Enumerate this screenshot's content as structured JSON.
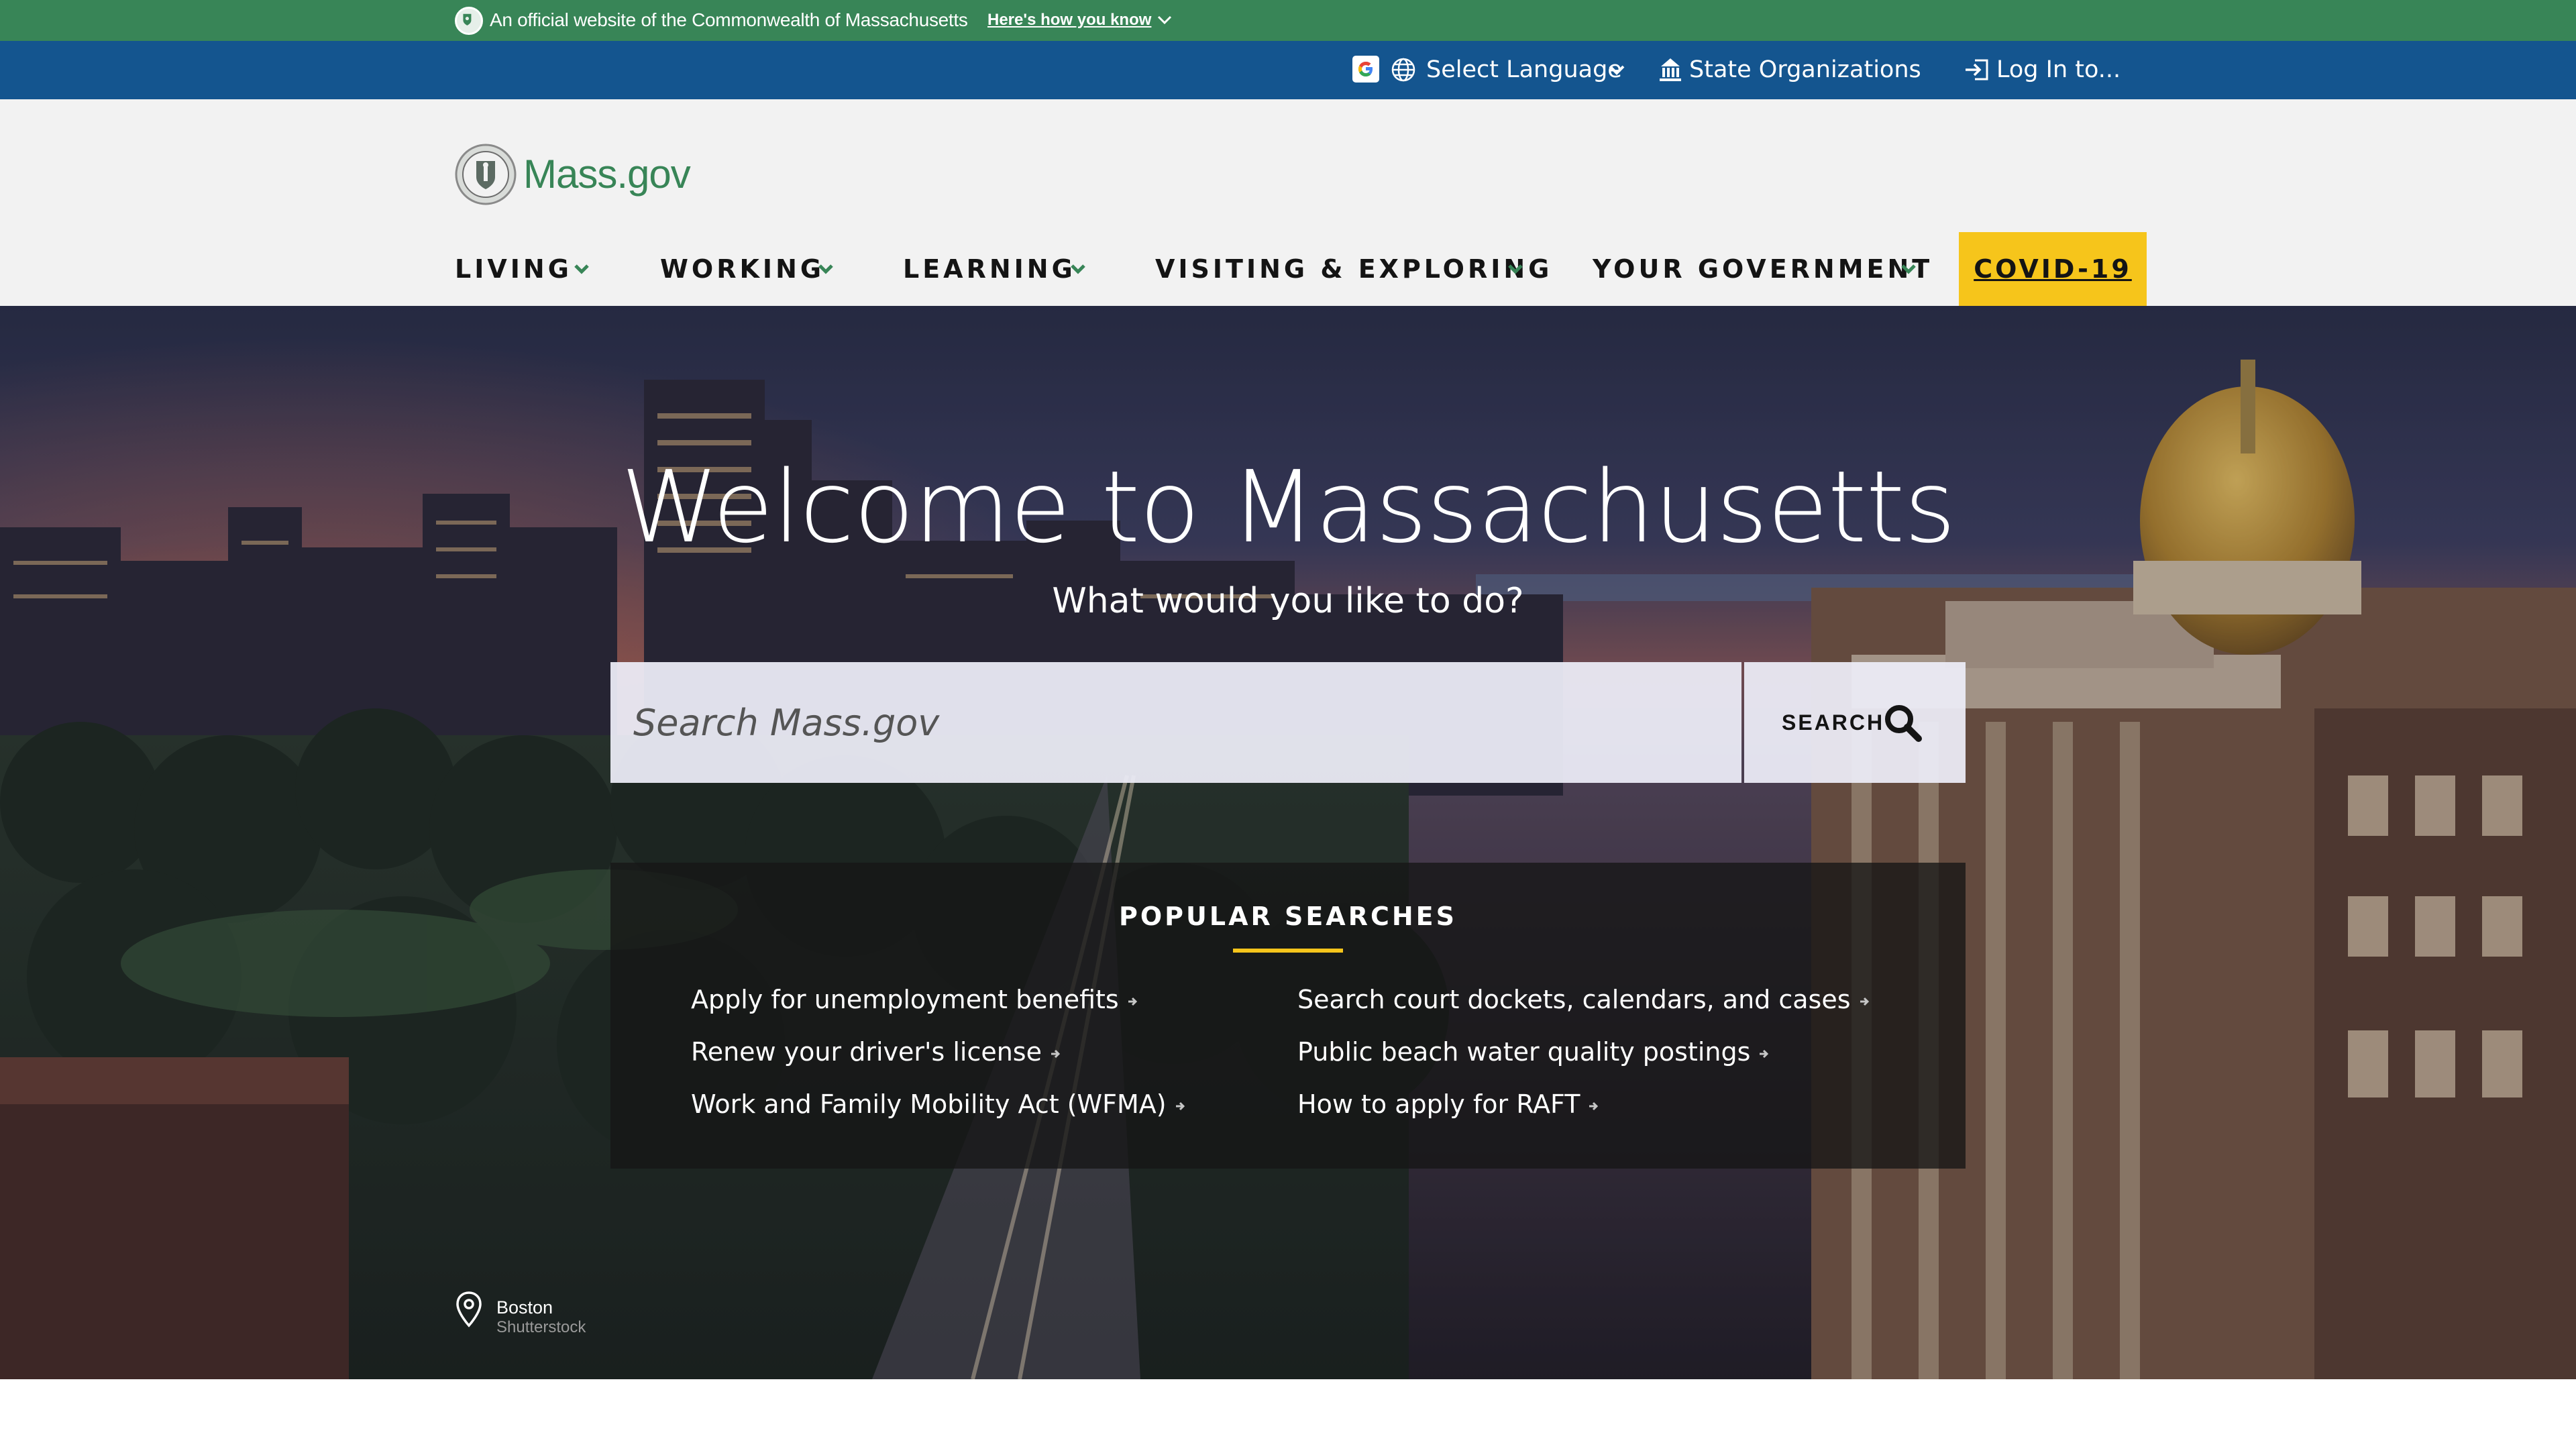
{
  "official_banner": {
    "text": "An official website of the Commonwealth of Massachusetts",
    "link": "Here's how you know"
  },
  "utility_nav": {
    "language_label": "Select Language",
    "state_orgs_label": "State Organizations",
    "login_label": "Log In to..."
  },
  "header": {
    "logo_text": "Mass.gov"
  },
  "main_nav": [
    {
      "label": "LIVING"
    },
    {
      "label": "WORKING"
    },
    {
      "label": "LEARNING"
    },
    {
      "label": "VISITING & EXPLORING"
    },
    {
      "label": "YOUR GOVERNMENT"
    }
  ],
  "covid_label": "COVID-19",
  "hero": {
    "title": "Welcome to Massachusetts",
    "subtitle": "What would you like to do?",
    "search_placeholder": "Search Mass.gov",
    "search_button_label": "SEARCH",
    "caption_place": "Boston",
    "caption_credit": "Shutterstock"
  },
  "popular_searches": {
    "title": "POPULAR SEARCHES",
    "links": [
      "Apply for unemployment benefits",
      "Search court dockets, calendars, and cases",
      "Renew your driver's license",
      "Public beach water quality postings",
      "Work and Family Mobility Act (WFMA)",
      "How to apply for RAFT"
    ]
  },
  "colors": {
    "official_green": "#388557",
    "utility_blue": "#14558f",
    "header_gray": "#f2f2f2",
    "covid_yellow": "#f6c51b",
    "nav_chevron": "#388557"
  },
  "icons": [
    "shield-seal-icon",
    "chevron-down-icon",
    "google-icon",
    "globe-icon",
    "building-icon",
    "login-icon",
    "search-icon",
    "arrow-right-icon",
    "map-pin-icon"
  ]
}
